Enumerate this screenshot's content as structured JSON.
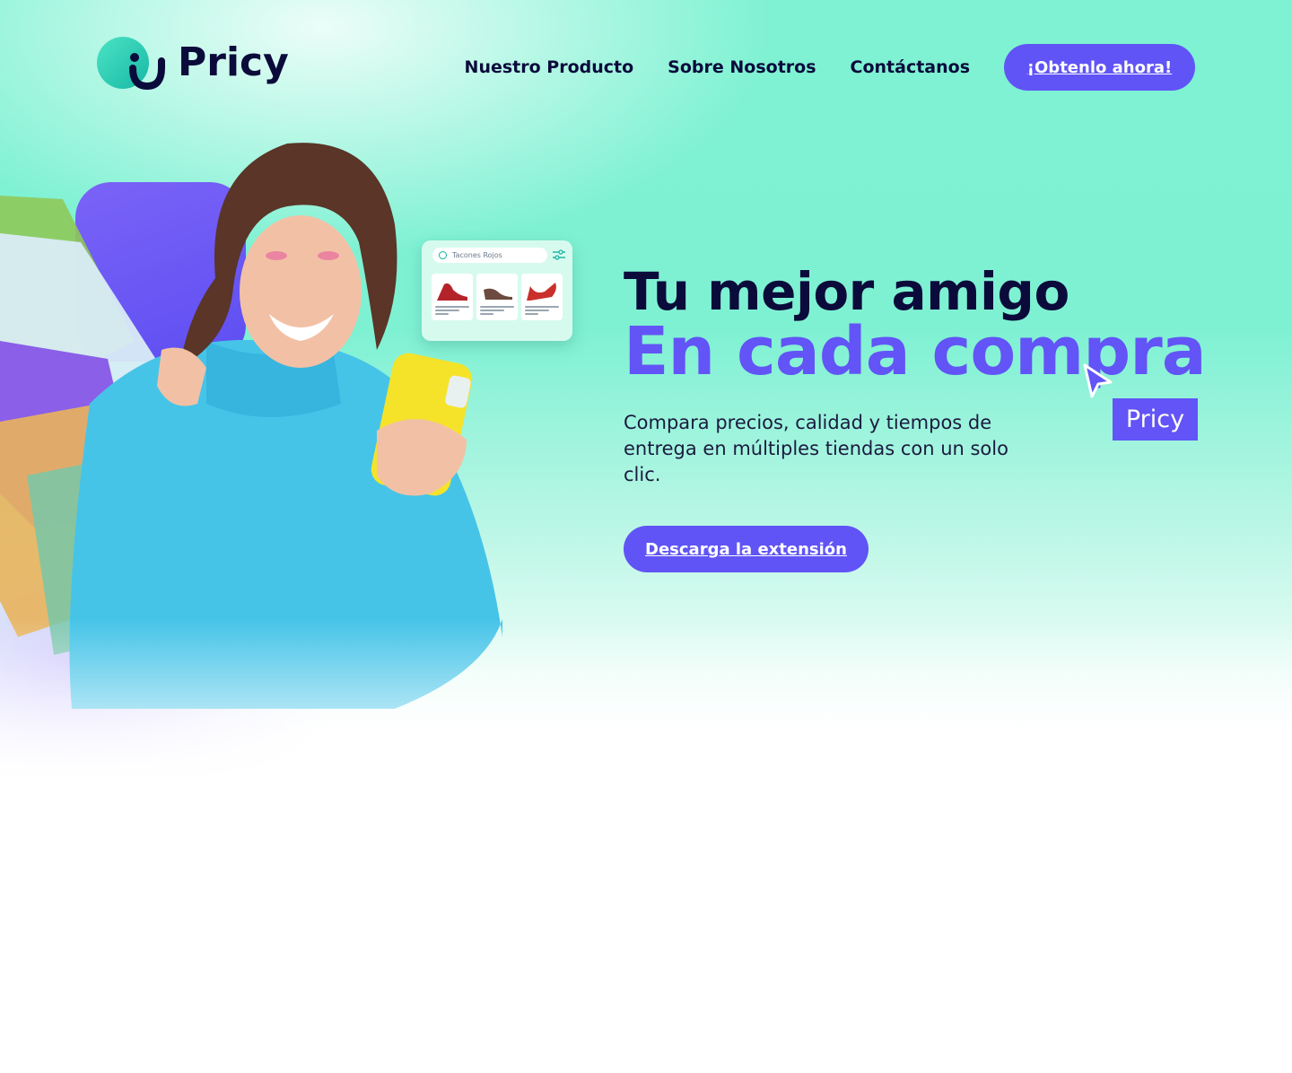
{
  "brand": {
    "name": "Pricy",
    "primary_color": "#6054f6",
    "dark_color": "#0b0b3b",
    "mint_color": "#7ef2d2"
  },
  "nav": {
    "links": [
      "Nuestro Producto",
      "Sobre Nosotros",
      "Contáctanos"
    ],
    "cta_label": "¡Obtenlo ahora!"
  },
  "hero": {
    "title_line1": "Tu mejor amigo",
    "title_line2": "En cada compra",
    "tag_label": "Pricy",
    "description": "Compara precios, calidad y tiempos de entrega en múltiples tiendas con un solo clic.",
    "cta_label": "Descarga la extensión",
    "search_card": {
      "query": "Tacones Rojos",
      "icons": [
        "search-icon",
        "filter-icon"
      ]
    },
    "image_subject": "woman-with-shopping-bags-and-phone"
  }
}
